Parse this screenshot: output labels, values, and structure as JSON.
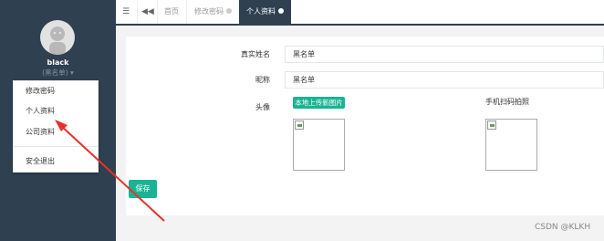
{
  "user": {
    "name": "black",
    "role": "(黑名单)"
  },
  "user_menu": {
    "items": [
      "修改密码",
      "个人资料",
      "公司资料"
    ],
    "logout": "安全退出"
  },
  "tabs": [
    {
      "label": "首页"
    },
    {
      "label": "修改密码"
    },
    {
      "label": "个人资料",
      "active": true
    }
  ],
  "form": {
    "real_name_label": "真实姓名",
    "real_name_value": "黑名单",
    "nickname_label": "昵称",
    "nickname_value": "黑名单",
    "avatar_label": "头像",
    "upload_label": "本地上传新图片",
    "qr_label": "手机扫码拍照",
    "save_label": "保存"
  },
  "watermark": "CSDN @KLKH",
  "colors": {
    "sidebar": "#2f4050",
    "primary": "#1ab394",
    "annotation_arrow": "#e8302a"
  }
}
